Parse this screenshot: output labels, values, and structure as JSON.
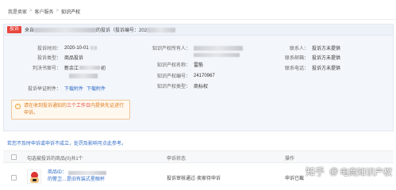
{
  "breadcrumb": {
    "home": "我是卖家",
    "section": "客户服务",
    "current": "知识产权",
    "separator": ">"
  },
  "complaint": {
    "tag": "投诉",
    "header_prefix": "来自",
    "header_suffix": "的投诉（投诉编号：202",
    "fields": {
      "time": {
        "label": "投诉时间：",
        "value": "2020-10-01"
      },
      "type": {
        "label": "投诉类型：",
        "value": "商品投诉"
      },
      "judgment": {
        "label": "判决书案号：",
        "value_prefix": "新余江",
        "value_suffix": "初"
      },
      "evidence": {
        "label": "投诉举证附件：",
        "link1": "下载附件",
        "link2": "下载附件"
      },
      "owner": {
        "label": "知识产权所有人：",
        "value": ""
      },
      "ip_name": {
        "label": "知识产权名称：",
        "value": "雷筋"
      },
      "ip_number": {
        "label": "知识产权编号：",
        "value": "24170967"
      },
      "ip_type": {
        "label": "知识产权类型：",
        "value": "商标权"
      },
      "contact": {
        "label": "联系人：",
        "value": "投诉方未提供"
      },
      "email": {
        "label": "联系邮箱：",
        "value": "投诉方未提供"
      },
      "phone": {
        "label": "联系电话：",
        "value": "投诉方未提供"
      }
    },
    "notice": {
      "before": "请在收到投诉通知的",
      "highlight": "三个工作日",
      "after": "内提供先证进行申诉。"
    }
  },
  "tip": "若您不及时申诉或申诉不成立，处罚及影响可点此参考。",
  "table": {
    "headers": {
      "product": "勾选被投诉的商品(0)共1个",
      "status": "申诉状态",
      "operation": "操作"
    },
    "rows": [
      {
        "name_prefix": "商品ID：",
        "name_suffix": "的警卫…是旧有装式星眼杯",
        "status": "投诉审核通过·卖家待申诉",
        "operation": "申诉已截"
      }
    ]
  },
  "watermark": {
    "logo": "知乎",
    "at": "@",
    "text": "电商知识产权"
  },
  "colors": {
    "accent": "#e8453c",
    "link": "#2f6bc7",
    "warning": "#e07b1d"
  }
}
